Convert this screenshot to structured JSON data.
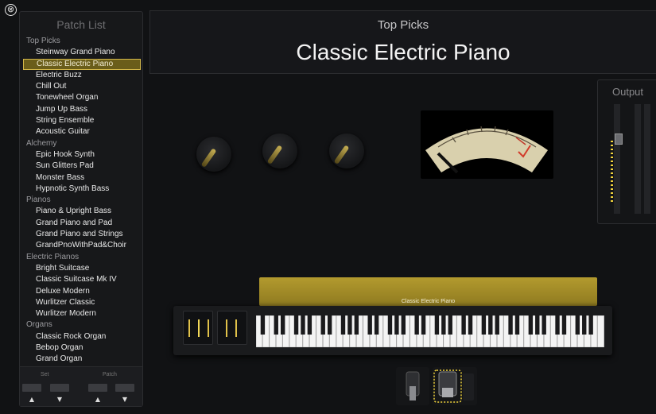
{
  "close_label": "⊗",
  "sidebar": {
    "title": "Patch List",
    "groups": [
      {
        "name": "Top Picks",
        "items": [
          "Steinway Grand Piano",
          "Classic Electric Piano",
          "Electric Buzz",
          "Chill Out",
          "Tonewheel Organ",
          "Jump Up Bass",
          "String Ensemble",
          "Acoustic Guitar"
        ]
      },
      {
        "name": "Alchemy",
        "items": [
          "Epic Hook Synth",
          "Sun Glitters Pad",
          "Monster Bass",
          "Hypnotic Synth Bass"
        ]
      },
      {
        "name": "Pianos",
        "items": [
          "Piano & Upright Bass",
          "Grand Piano and Pad",
          "Grand Piano and Strings",
          "GrandPnoWithPad&Choir"
        ]
      },
      {
        "name": "Electric Pianos",
        "items": [
          "Bright Suitcase",
          "Classic Suitcase Mk IV",
          "Deluxe Modern",
          "Wurlitzer Classic",
          "Wurlitzer Modern"
        ]
      },
      {
        "name": "Organs",
        "items": [
          "Classic Rock Organ",
          "Bebop Organ",
          "Grand Organ"
        ]
      }
    ],
    "selected": "Classic Electric Piano",
    "footer": {
      "set_label": "Set",
      "patch_label": "Patch",
      "up": "▲",
      "down": "▼"
    }
  },
  "header": {
    "category": "Top Picks",
    "patch_name": "Classic Electric Piano"
  },
  "output": {
    "label": "Output"
  },
  "keyboard": {
    "patch_label": "Classic Electric Piano"
  },
  "colors": {
    "accent": "#d4b84a",
    "gold_bar": "#a78f28",
    "meter": "#f0d23c"
  }
}
